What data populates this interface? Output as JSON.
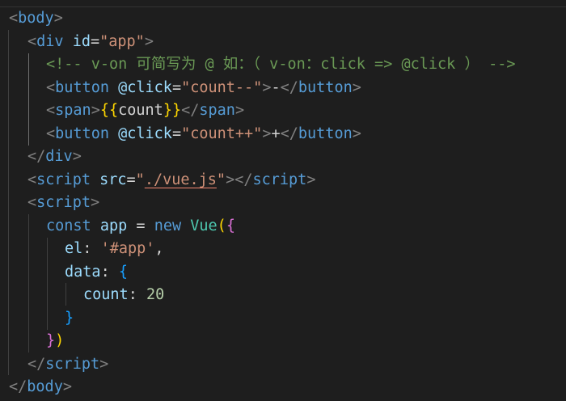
{
  "code": {
    "l1": {
      "open": "<",
      "tag": "body",
      "close": ">"
    },
    "l2": {
      "open": "<",
      "tag": "div",
      "attr": " id",
      "eq": "=",
      "val": "\"app\"",
      "close": ">"
    },
    "l3": {
      "comment": "<!-- v-on 可简写为 @ 如：（ v-on：click => @click ） -->"
    },
    "l4": {
      "open": "<",
      "tag": "button",
      "attr": " @click",
      "eq": "=",
      "val": "\"count--\"",
      "close": ">",
      "text": "-",
      "end_open": "</",
      "end_tag": "button",
      "end_close": ">"
    },
    "l5": {
      "open": "<",
      "tag": "span",
      "close": ">",
      "mus_open": "{{",
      "expr": "count",
      "mus_close": "}}",
      "end_open": "</",
      "end_tag": "span",
      "end_close": ">"
    },
    "l6": {
      "open": "<",
      "tag": "button",
      "attr": " @click",
      "eq": "=",
      "val": "\"count++\"",
      "close": ">",
      "text": "+",
      "end_open": "</",
      "end_tag": "button",
      "end_close": ">"
    },
    "l7": {
      "end_open": "</",
      "end_tag": "div",
      "end_close": ">"
    },
    "l8": {
      "open": "<",
      "tag": "script",
      "attr": " src",
      "eq": "=",
      "q1": "\"",
      "src": "./vue.js",
      "q2": "\"",
      "close": ">",
      "end_open": "</",
      "end_tag": "script",
      "end_close": ">"
    },
    "l9": {
      "open": "<",
      "tag": "script",
      "close": ">"
    },
    "l10": {
      "kw_const": "const",
      "name": " app",
      "op": " = ",
      "kw_new": "new",
      "cls": " Vue",
      "p_open": "(",
      "b_open": "{"
    },
    "l11": {
      "key": "el",
      "colon": ": ",
      "val": "'#app'",
      "comma": ","
    },
    "l12": {
      "key": "data",
      "colon": ": ",
      "b_open": "{"
    },
    "l13": {
      "key": "count",
      "colon": ": ",
      "num": "20"
    },
    "l14": {
      "b_close": "}"
    },
    "l15": {
      "b_close": "}",
      "p_close": ")"
    },
    "l16": {
      "end_open": "</",
      "end_tag": "script",
      "end_close": ">"
    },
    "l17": {
      "end_open": "</",
      "end_tag": "body",
      "end_close": ">"
    }
  }
}
